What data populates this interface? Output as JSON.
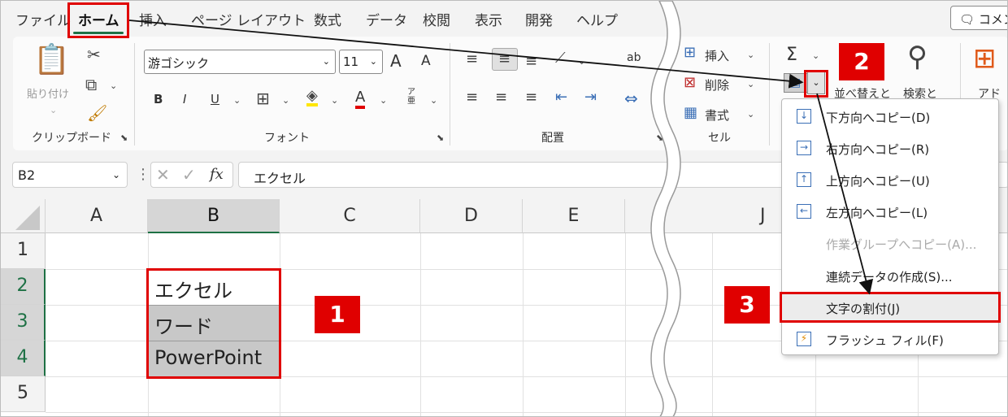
{
  "menubar": {
    "tabs": [
      "ファイル",
      "ホーム",
      "挿入",
      "ページ レイアウト",
      "数式",
      "データ",
      "校閲",
      "表示",
      "開発",
      "ヘルプ"
    ],
    "comment_label": "コメン"
  },
  "ribbon": {
    "clipboard": {
      "paste_label": "貼り付け",
      "group_label": "クリップボード"
    },
    "font": {
      "font_name": "游ゴシック",
      "font_size": "11",
      "bold": "B",
      "italic": "I",
      "underline": "U",
      "group_label": "フォント",
      "grow_font": "A",
      "shrink_font": "A",
      "phonetic": "ア亜"
    },
    "alignment": {
      "group_label": "配置",
      "wrap_icon": "ab"
    },
    "cells": {
      "insert_label": "挿入",
      "delete_label": "削除",
      "format_label": "書式",
      "group_label": "セル"
    },
    "editing": {
      "sigma": "Σ",
      "sort_label": "並べ替えと",
      "find_label": "検索と"
    },
    "addins": {
      "label": "アド"
    }
  },
  "formula_bar": {
    "name_box": "B2",
    "fx": "fx",
    "value": "エクセル"
  },
  "grid": {
    "columns": [
      "A",
      "B",
      "C",
      "D",
      "E",
      "J"
    ],
    "rows": [
      "1",
      "2",
      "3",
      "4",
      "5"
    ],
    "cells": {
      "B2": "エクセル",
      "B3": "ワード",
      "B4": "PowerPoint"
    }
  },
  "fill_menu": {
    "items": [
      {
        "label": "下方向へコピー(D)",
        "icon": "arrow-down-icon",
        "glyph": "↓",
        "disabled": false
      },
      {
        "label": "右方向へコピー(R)",
        "icon": "arrow-right-icon",
        "glyph": "→",
        "disabled": false
      },
      {
        "label": "上方向へコピー(U)",
        "icon": "arrow-up-icon",
        "glyph": "↑",
        "disabled": false
      },
      {
        "label": "左方向へコピー(L)",
        "icon": "arrow-left-icon",
        "glyph": "←",
        "disabled": false
      },
      {
        "label": "作業グループへコピー(A)...",
        "icon": "",
        "glyph": "",
        "disabled": true
      },
      {
        "label": "連続データの作成(S)...",
        "icon": "",
        "glyph": "",
        "disabled": false
      },
      {
        "label": "文字の割付(J)",
        "icon": "",
        "glyph": "",
        "disabled": false
      },
      {
        "label": "フラッシュ フィル(F)",
        "icon": "flash-fill-icon",
        "glyph": "⚡",
        "disabled": false
      }
    ]
  },
  "annotations": {
    "step1": "1",
    "step2": "2",
    "step3": "3"
  },
  "colors": {
    "accent_green": "#1e7145",
    "annotation_red": "#e00000",
    "selection_gray": "#c8c8c8"
  }
}
